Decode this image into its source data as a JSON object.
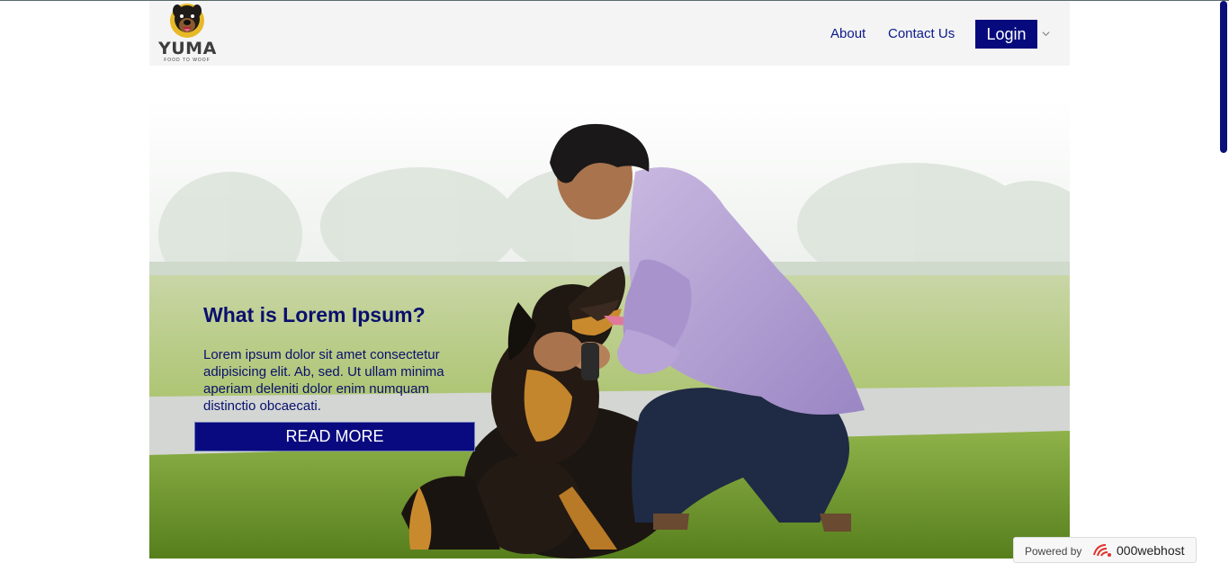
{
  "header": {
    "logo_name": "YUMA",
    "logo_tagline": "FOOD TO WOOF",
    "nav": {
      "about": "About",
      "contact": "Contact Us",
      "login": "Login"
    }
  },
  "hero": {
    "title": "What is Lorem Ipsum?",
    "body": "Lorem ipsum dolor sit amet consectetur adipisicing elit. Ab, sed. Ut ullam minima aperiam deleniti dolor enim numquam distinctio obcaecati.",
    "cta": "READ MORE"
  },
  "footer_badge": {
    "powered_by": "Powered by",
    "host": "000webhost"
  },
  "colors": {
    "brand_navy": "#070a7c",
    "header_bg": "#f4f4f4",
    "text_navy": "#0a0f6e"
  }
}
